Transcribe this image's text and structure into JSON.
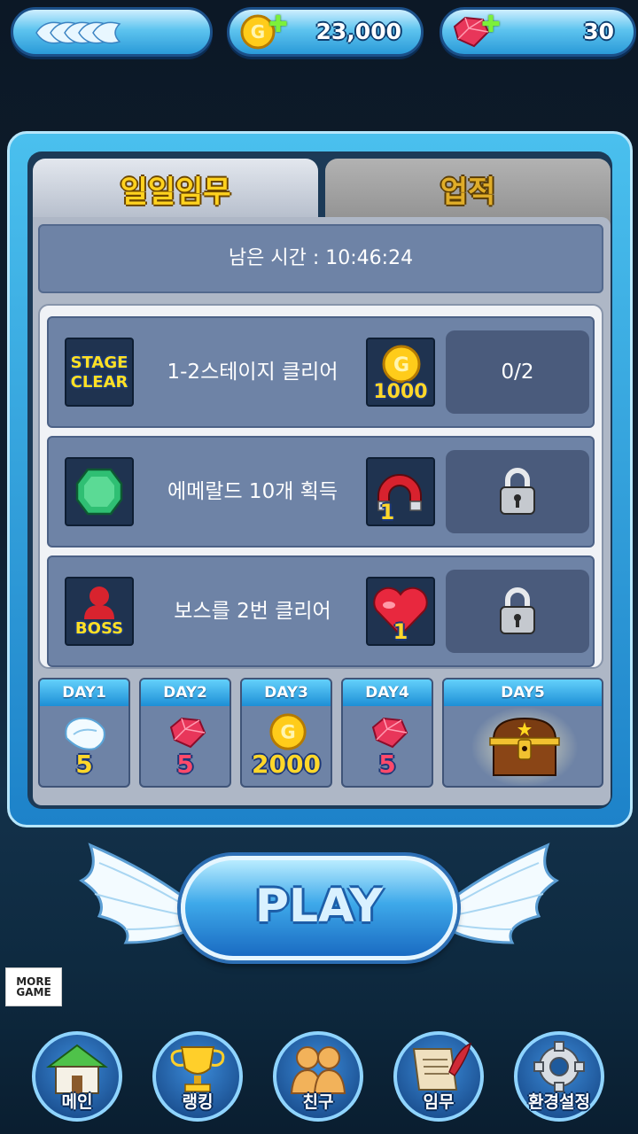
{
  "top_bar": {
    "gold_value": "23,000",
    "gem_value": "30"
  },
  "tabs": {
    "daily": "일일임무",
    "achievement": "업적"
  },
  "timer_text": "남은 시간 : 10:46:24",
  "missions": [
    {
      "icon_line1": "STAGE",
      "icon_line2": "CLEAR",
      "text": "1-2스테이지 클리어",
      "reward_value": "1000",
      "status": "0/2"
    },
    {
      "text": "에메랄드 10개 획득",
      "reward_value": "1"
    },
    {
      "icon_label": "BOSS",
      "text": "보스를 2번 클리어",
      "reward_value": "1"
    }
  ],
  "days": [
    {
      "label": "DAY1",
      "value": "5"
    },
    {
      "label": "DAY2",
      "value": "5"
    },
    {
      "label": "DAY3",
      "value": "2000"
    },
    {
      "label": "DAY4",
      "value": "5"
    },
    {
      "label": "DAY5"
    }
  ],
  "play_label": "PLAY",
  "more_game": {
    "line1": "MORE",
    "line2": "GAME"
  },
  "nav": [
    "메인",
    "랭킹",
    "친구",
    "임무",
    "환경설정"
  ],
  "colors": {
    "accent": "#2a9ad8",
    "panel": "#6e83a6",
    "gold": "#ffd21f"
  }
}
